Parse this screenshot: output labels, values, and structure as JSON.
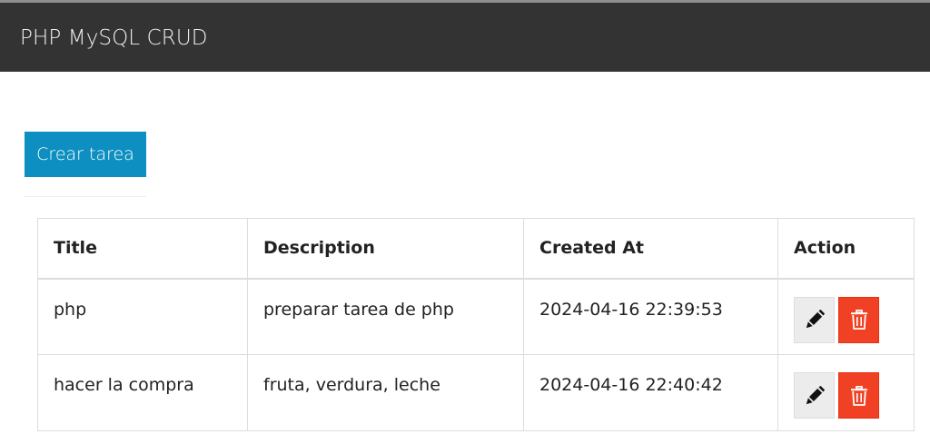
{
  "navbar": {
    "brand": "PHP MySQL CRUD"
  },
  "toolbar": {
    "create_label": "Crear tarea"
  },
  "table": {
    "headers": {
      "title": "Title",
      "description": "Description",
      "created_at": "Created At",
      "action": "Action"
    },
    "rows": [
      {
        "title": "php",
        "description": "preparar tarea de php",
        "created_at": "2024-04-16 22:39:53"
      },
      {
        "title": "hacer la compra",
        "description": "fruta, verdura, leche",
        "created_at": "2024-04-16 22:40:42"
      }
    ]
  },
  "icons": {
    "edit": "pencil-icon",
    "delete": "trash-icon"
  },
  "colors": {
    "navbar": "#333333",
    "primary": "#0d8fc1",
    "danger": "#f04124",
    "edit_bg": "#ececec"
  }
}
